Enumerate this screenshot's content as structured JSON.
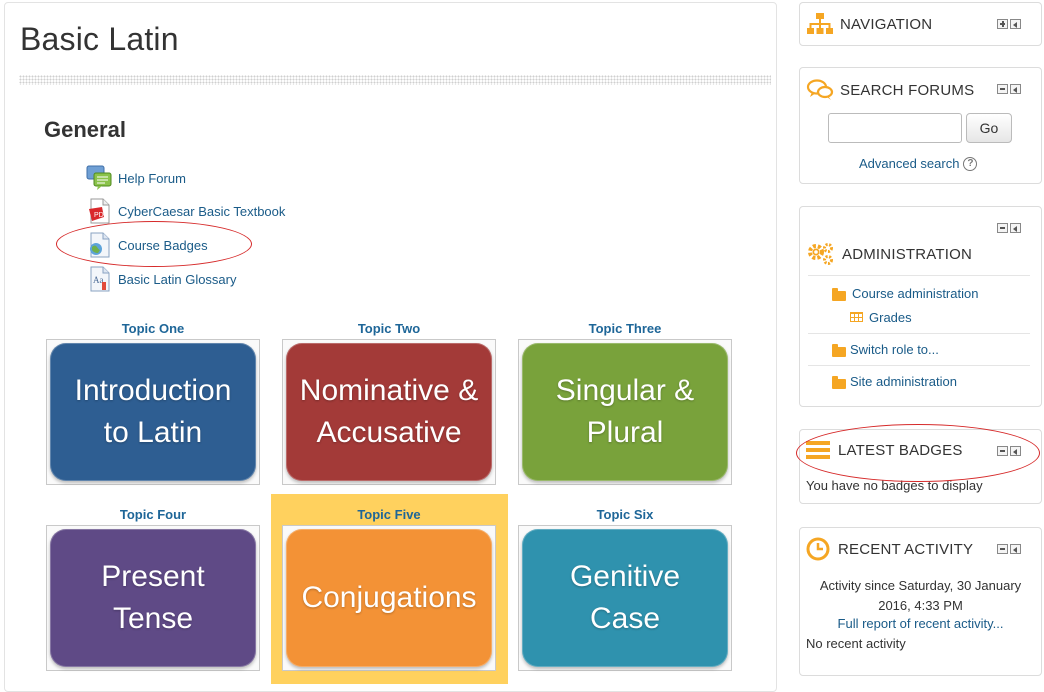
{
  "course": {
    "title": "Basic Latin",
    "section_title": "General"
  },
  "activities": [
    {
      "label": "Help Forum",
      "icon": "forum-icon"
    },
    {
      "label": "CyberCaesar Basic Textbook",
      "icon": "pdf-icon"
    },
    {
      "label": "Course Badges",
      "icon": "page-icon"
    },
    {
      "label": "Basic Latin Glossary",
      "icon": "glossary-icon"
    }
  ],
  "topics": [
    {
      "name": "Topic One",
      "tile": "Introduction to Latin",
      "color": "#2e5e92"
    },
    {
      "name": "Topic Two",
      "tile": "Nominative & Accusative",
      "color": "#a33a38"
    },
    {
      "name": "Topic Three",
      "tile": "Singular & Plural",
      "color": "#79a23b"
    },
    {
      "name": "Topic Four",
      "tile": "Present Tense",
      "color": "#5f4a86"
    },
    {
      "name": "Topic Five",
      "tile": "Conjugations",
      "color": "#f39236"
    },
    {
      "name": "Topic Six",
      "tile": "Genitive Case",
      "color": "#2f92ae"
    }
  ],
  "blocks": {
    "navigation": {
      "title": "NAVIGATION"
    },
    "search_forums": {
      "title": "SEARCH FORUMS",
      "input_value": "",
      "go_label": "Go",
      "advanced_label": "Advanced search"
    },
    "administration": {
      "title": "ADMINISTRATION",
      "course_admin": "Course administration",
      "grades": "Grades",
      "switch_role": "Switch role to...",
      "site_admin": "Site administration"
    },
    "latest_badges": {
      "title": "LATEST BADGES",
      "empty_text": "You have no badges to display"
    },
    "recent_activity": {
      "title": "RECENT ACTIVITY",
      "since_line1": "Activity since Saturday, 30 January",
      "since_line2": "2016, 4:33 PM",
      "full_report": "Full report of recent activity...",
      "none": "No recent activity"
    }
  },
  "colors": {
    "link": "#1a5b88",
    "accent": "#f5a623",
    "annotation_circle": "#d62a2a",
    "highlight": "#ffd15e"
  }
}
